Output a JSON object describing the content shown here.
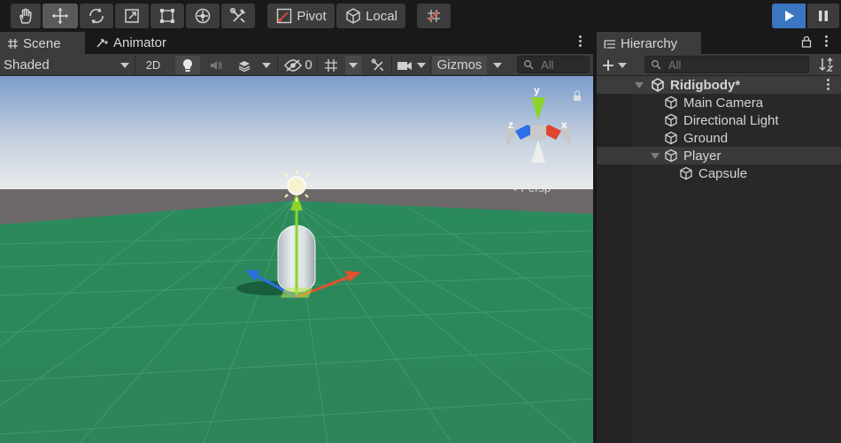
{
  "toolbar": {
    "tools": [
      {
        "id": "hand",
        "icon": "hand-tool-icon"
      },
      {
        "id": "move",
        "icon": "move-tool-icon",
        "active": true
      },
      {
        "id": "rotate",
        "icon": "rotate-tool-icon"
      },
      {
        "id": "scale",
        "icon": "scale-tool-icon"
      },
      {
        "id": "rect",
        "icon": "rect-tool-icon"
      },
      {
        "id": "transform",
        "icon": "transform-tool-icon"
      },
      {
        "id": "custom",
        "icon": "custom-tool-icon"
      }
    ],
    "pivot_label": "Pivot",
    "local_label": "Local",
    "snap_icon": "grid-snap-icon",
    "play_icon": "play-icon",
    "pause_icon": "pause-icon",
    "accent": "#3a76c2"
  },
  "scene_panel": {
    "tabs": [
      {
        "label": "Scene",
        "icon": "grid-icon",
        "active": true
      },
      {
        "label": "Animator",
        "icon": "animator-icon",
        "active": false
      }
    ],
    "shading_mode": "Shaded",
    "toggle_2d": "2D",
    "hidden_count": "0",
    "gizmos_label": "Gizmos",
    "search_placeholder": "All",
    "gizmo_axes": {
      "y": "y",
      "z": "z",
      "x": "x"
    },
    "view_label": "< Persp",
    "colors": {
      "ground": "#2e8a5c",
      "sky_top": "#7f9fcc",
      "horizon": "#e3e6ea",
      "far_ground": "#6e6a6b"
    }
  },
  "hierarchy": {
    "tab_label": "Hierarchy",
    "search_placeholder": "All",
    "scene_name": "Ridigbody*",
    "items": [
      {
        "label": "Main Camera",
        "depth": 1
      },
      {
        "label": "Directional Light",
        "depth": 1
      },
      {
        "label": "Ground",
        "depth": 1
      },
      {
        "label": "Player",
        "depth": 1,
        "expanded": true,
        "selected": true
      },
      {
        "label": "Capsule",
        "depth": 2
      }
    ]
  }
}
